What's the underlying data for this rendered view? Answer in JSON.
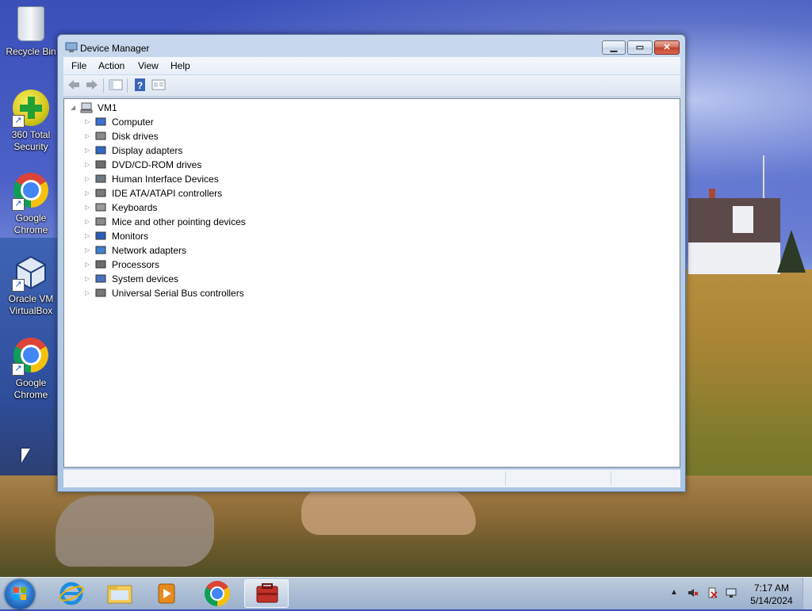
{
  "desktop": {
    "icons": [
      {
        "label": "Recycle Bin",
        "icon": "recycle-bin-icon"
      },
      {
        "label": "360 Total Security",
        "icon": "360-security-icon"
      },
      {
        "label": "Google Chrome",
        "icon": "chrome-icon"
      },
      {
        "label": "Oracle VM VirtualBox",
        "icon": "virtualbox-icon"
      },
      {
        "label": "Google Chrome",
        "icon": "chrome-icon"
      }
    ]
  },
  "window": {
    "title": "Device Manager",
    "buttons": {
      "minimize": "minimize",
      "maximize": "maximize",
      "close": "close"
    },
    "menu": [
      "File",
      "Action",
      "View",
      "Help"
    ],
    "toolbar": [
      "back-arrow-icon",
      "forward-arrow-icon",
      "show-hide-tree-icon",
      "help-icon",
      "properties-icon"
    ],
    "tree": {
      "root": "VM1",
      "children": [
        {
          "label": "Computer",
          "icon": "computer-icon"
        },
        {
          "label": "Disk drives",
          "icon": "disk-drive-icon"
        },
        {
          "label": "Display adapters",
          "icon": "display-adapter-icon"
        },
        {
          "label": "DVD/CD-ROM drives",
          "icon": "dvd-drive-icon"
        },
        {
          "label": "Human Interface Devices",
          "icon": "hid-icon"
        },
        {
          "label": "IDE ATA/ATAPI controllers",
          "icon": "ide-controller-icon"
        },
        {
          "label": "Keyboards",
          "icon": "keyboard-icon"
        },
        {
          "label": "Mice and other pointing devices",
          "icon": "mouse-icon"
        },
        {
          "label": "Monitors",
          "icon": "monitor-icon"
        },
        {
          "label": "Network adapters",
          "icon": "network-adapter-icon"
        },
        {
          "label": "Processors",
          "icon": "processor-icon"
        },
        {
          "label": "System devices",
          "icon": "system-devices-icon"
        },
        {
          "label": "Universal Serial Bus controllers",
          "icon": "usb-icon"
        }
      ]
    }
  },
  "taskbar": {
    "pinned": [
      "start-orb-icon",
      "internet-explorer-icon",
      "file-explorer-icon",
      "media-player-icon",
      "chrome-icon",
      "device-manager-icon"
    ],
    "tray": [
      "show-hidden-icons",
      "volume-muted-icon",
      "action-center-icon",
      "network-icon"
    ],
    "time": "7:17 AM",
    "date": "5/14/2024"
  }
}
